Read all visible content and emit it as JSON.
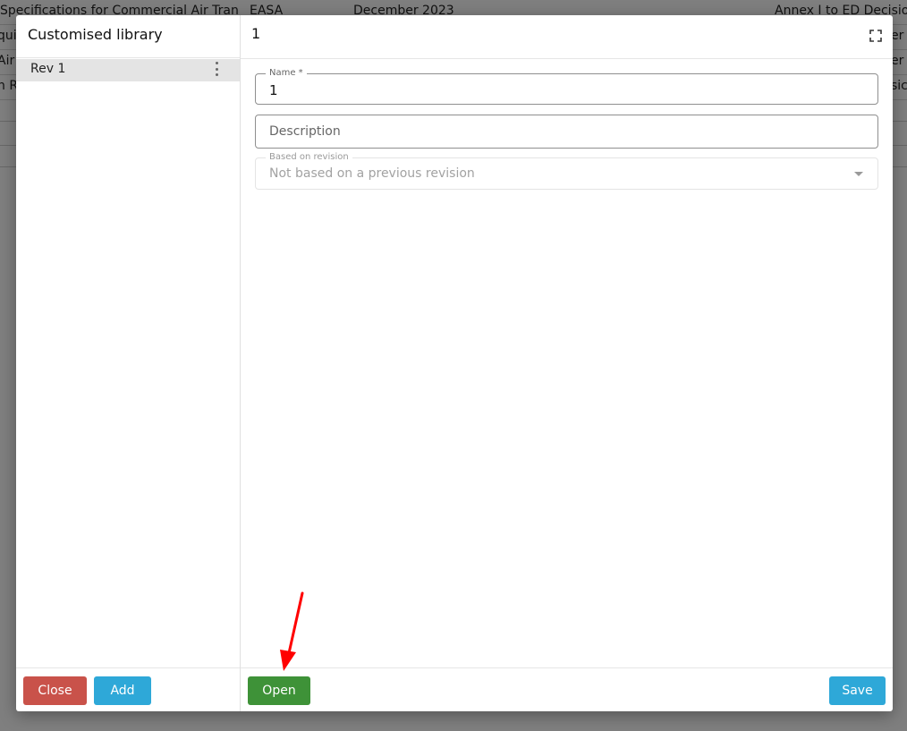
{
  "background_table": {
    "rows": [
      {
        "title": "Specifications for Commercial Air Trans...",
        "org": "EASA",
        "date": "December 2023",
        "ref": "Annex I to ED Decision"
      },
      {
        "title": "qui",
        "org": "",
        "date": "",
        "ref": "er"
      },
      {
        "title": "Air",
        "org": "",
        "date": "",
        "ref": "er"
      },
      {
        "title": "n R",
        "org": "",
        "date": "",
        "ref": "sic"
      }
    ]
  },
  "dialog": {
    "sidebar": {
      "title": "Customised library",
      "items": [
        {
          "label": "Rev 1"
        }
      ],
      "close_label": "Close",
      "add_label": "Add"
    },
    "main": {
      "title": "1",
      "form": {
        "name": {
          "legend": "Name *",
          "value": "1"
        },
        "description": {
          "placeholder": "Description",
          "value": ""
        },
        "based_on": {
          "legend": "Based on revision",
          "value": "Not based on a previous revision"
        }
      },
      "open_label": "Open",
      "save_label": "Save"
    }
  },
  "colors": {
    "close_button": "#c9524a",
    "add_button": "#2ea8d8",
    "open_button": "#3e9238",
    "save_button": "#2ea8d8",
    "annotation_arrow": "#ff0000"
  },
  "icons": {
    "fullscreen": "fullscreen-icon",
    "more": "more-vert-icon",
    "dropdown": "caret-down-icon"
  }
}
